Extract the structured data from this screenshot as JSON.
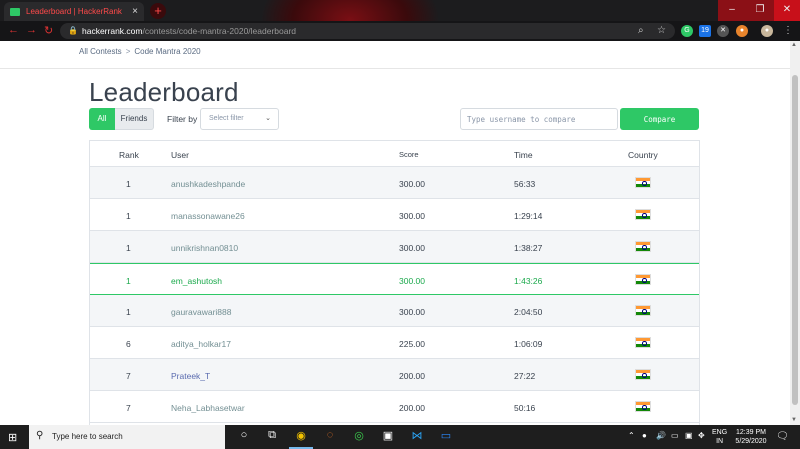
{
  "browser": {
    "tab_title": "Leaderboard | HackerRank",
    "tab_close": "×",
    "new_tab": "+",
    "url_host": "hackerrank.com",
    "url_path": "/contests/code-mantra-2020/leaderboard",
    "extension_badge": "19",
    "window_controls": {
      "minimize": "–",
      "maximize": "❐",
      "close": "✕"
    }
  },
  "breadcrumb": {
    "items": [
      "All Contests",
      "Code Mantra 2020"
    ],
    "separator": ">"
  },
  "page_title": "Leaderboard",
  "controls": {
    "tab_all": "All",
    "tab_friends": "Friends",
    "filter_label": "Filter by",
    "filter_placeholder": "Select filter",
    "compare_placeholder": "Type username to compare",
    "compare_button": "Compare"
  },
  "table": {
    "headers": {
      "rank": "Rank",
      "user": "User",
      "score": "Score",
      "time": "Time",
      "country": "Country"
    },
    "rows": [
      {
        "rank": "1",
        "user": "anushkadeshpande",
        "score": "300.00",
        "time": "56:33",
        "country": "India"
      },
      {
        "rank": "1",
        "user": "manassonawane26",
        "score": "300.00",
        "time": "1:29:14",
        "country": "India"
      },
      {
        "rank": "1",
        "user": "unnikrishnan0810",
        "score": "300.00",
        "time": "1:38:27",
        "country": "India"
      },
      {
        "rank": "1",
        "user": "em_ashutosh",
        "score": "300.00",
        "time": "1:43:26",
        "country": "India",
        "current_user": true
      },
      {
        "rank": "1",
        "user": "gauravawari888",
        "score": "300.00",
        "time": "2:04:50",
        "country": "India"
      },
      {
        "rank": "6",
        "user": "aditya_holkar17",
        "score": "225.00",
        "time": "1:06:09",
        "country": "India"
      },
      {
        "rank": "7",
        "user": "Prateek_T",
        "score": "200.00",
        "time": "27:22",
        "country": "India"
      },
      {
        "rank": "7",
        "user": "Neha_Labhasetwar",
        "score": "200.00",
        "time": "50:16",
        "country": "India"
      }
    ]
  },
  "taskbar": {
    "search_placeholder": "Type here to search",
    "language": "ENG",
    "region": "IN",
    "time": "12:39 PM",
    "date": "5/29/2020"
  },
  "colors": {
    "accent_green": "#2ec866",
    "current_user_text": "#1ba94c",
    "heading_text": "#39424e"
  }
}
